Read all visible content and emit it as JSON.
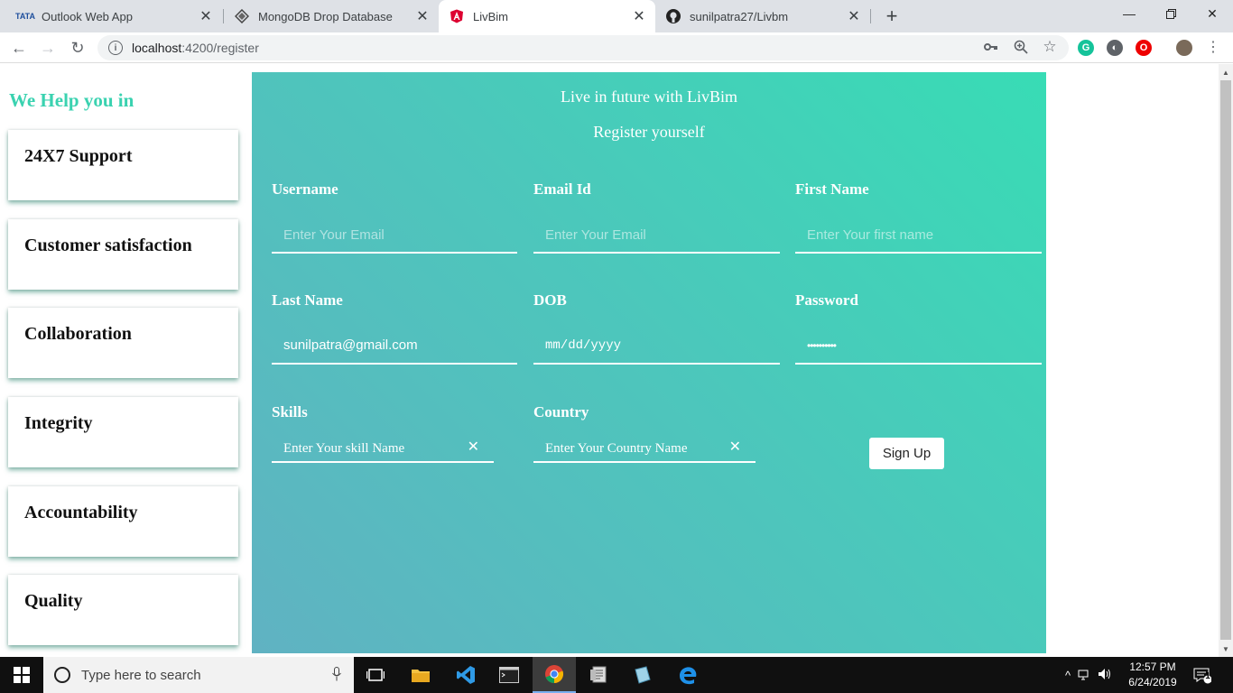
{
  "browser": {
    "tabs": [
      {
        "title": "Outlook Web App",
        "favicon": "tata-icon"
      },
      {
        "title": "MongoDB Drop Database",
        "favicon": "mongodb-icon"
      },
      {
        "title": "LivBim",
        "favicon": "angular-icon"
      },
      {
        "title": "sunilpatra27/Livbm",
        "favicon": "github-icon"
      }
    ],
    "url_host": "localhost",
    "url_path": ":4200/register"
  },
  "sidebar": {
    "title": "We Help you in",
    "items": [
      "24X7 Support",
      "Customer satisfaction",
      "Collaboration",
      "Integrity",
      "Accountability",
      "Quality"
    ]
  },
  "form": {
    "tagline": "Live in future with LivBim",
    "heading": "Register yourself",
    "username": {
      "label": "Username",
      "placeholder": "Enter Your Email"
    },
    "email": {
      "label": "Email Id",
      "placeholder": "Enter Your Email"
    },
    "first_name": {
      "label": "First Name",
      "placeholder": "Enter Your first name"
    },
    "last_name": {
      "label": "Last Name",
      "value": "sunilpatra@gmail.com"
    },
    "dob": {
      "label": "DOB",
      "value": "mm/dd/yyyy"
    },
    "password": {
      "label": "Password",
      "value": "••••••••••"
    },
    "skills": {
      "label": "Skills",
      "value": "Enter Your skill Name"
    },
    "country": {
      "label": "Country",
      "value": "Enter Your Country Name"
    },
    "submit": "Sign Up"
  },
  "taskbar": {
    "search_placeholder": "Type here to search",
    "time": "12:57 PM",
    "date": "6/24/2019",
    "notification_count": "1"
  },
  "colors": {
    "accent": "#3ad2b0",
    "panel_start": "#38dcb5",
    "panel_end": "#60b2c2"
  }
}
